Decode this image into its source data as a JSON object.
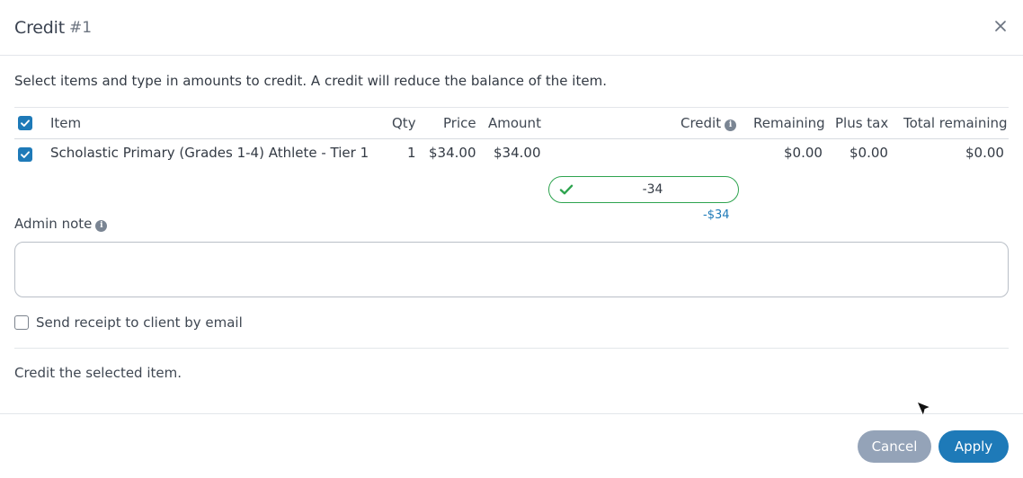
{
  "dialog": {
    "title": "Credit",
    "title_number": "#1"
  },
  "intro": "Select items and type in amounts to credit. A credit will reduce the balance of the item.",
  "table": {
    "headers": {
      "item": "Item",
      "qty": "Qty",
      "price": "Price",
      "amount": "Amount",
      "credit": "Credit",
      "remaining": "Remaining",
      "plus_tax": "Plus tax",
      "total_remaining": "Total remaining"
    },
    "rows": [
      {
        "item": "Scholastic Primary (Grades 1-4) Athlete - Tier 1",
        "qty": "1",
        "price": "$34.00",
        "amount": "$34.00",
        "credit_value": "-34",
        "credit_display": "-$34",
        "remaining": "$0.00",
        "plus_tax": "$0.00",
        "total_remaining": "$0.00",
        "checked": true
      }
    ]
  },
  "admin_note": {
    "label": "Admin note",
    "value": ""
  },
  "receipt": {
    "label": "Send receipt to client by email",
    "checked": false
  },
  "summary": "Credit the selected item.",
  "buttons": {
    "cancel": "Cancel",
    "apply": "Apply"
  },
  "colors": {
    "accent": "#1e7ab8",
    "success": "#2ea44f",
    "cancel": "#94a3b8"
  }
}
